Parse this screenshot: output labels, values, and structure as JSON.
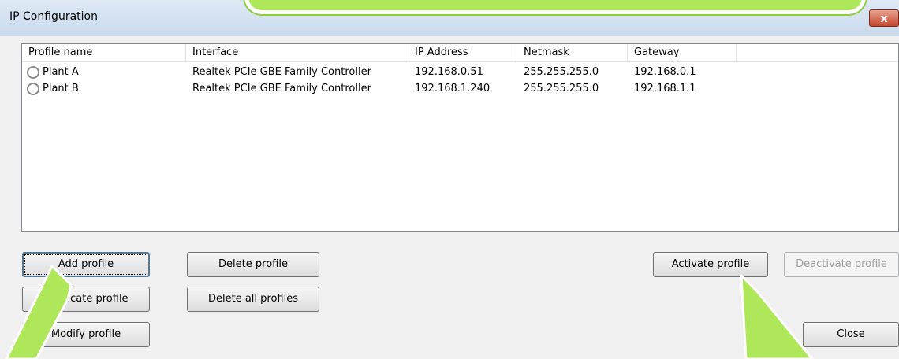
{
  "window": {
    "title": "IP Configuration",
    "close_glyph": "x"
  },
  "table": {
    "columns": [
      "Profile name",
      "Interface",
      "IP Address",
      "Netmask",
      "Gateway"
    ],
    "rows": [
      {
        "name": "Plant A",
        "interface": "Realtek PCIe GBE Family Controller",
        "ip": "192.168.0.51",
        "netmask": "255.255.255.0",
        "gateway": "192.168.0.1"
      },
      {
        "name": "Plant B",
        "interface": "Realtek PCIe GBE Family Controller",
        "ip": "192.168.1.240",
        "netmask": "255.255.255.0",
        "gateway": "192.168.1.1"
      }
    ]
  },
  "buttons": {
    "add": "Add profile",
    "duplicate": "Duplicate profile",
    "modify": "Modify profile",
    "delete": "Delete profile",
    "delete_all": "Delete all profiles",
    "activate": "Activate profile",
    "deactivate": "Deactivate profile",
    "close": "Close"
  },
  "colors": {
    "callout": "#aee85a",
    "arrow": "#aee85a"
  }
}
